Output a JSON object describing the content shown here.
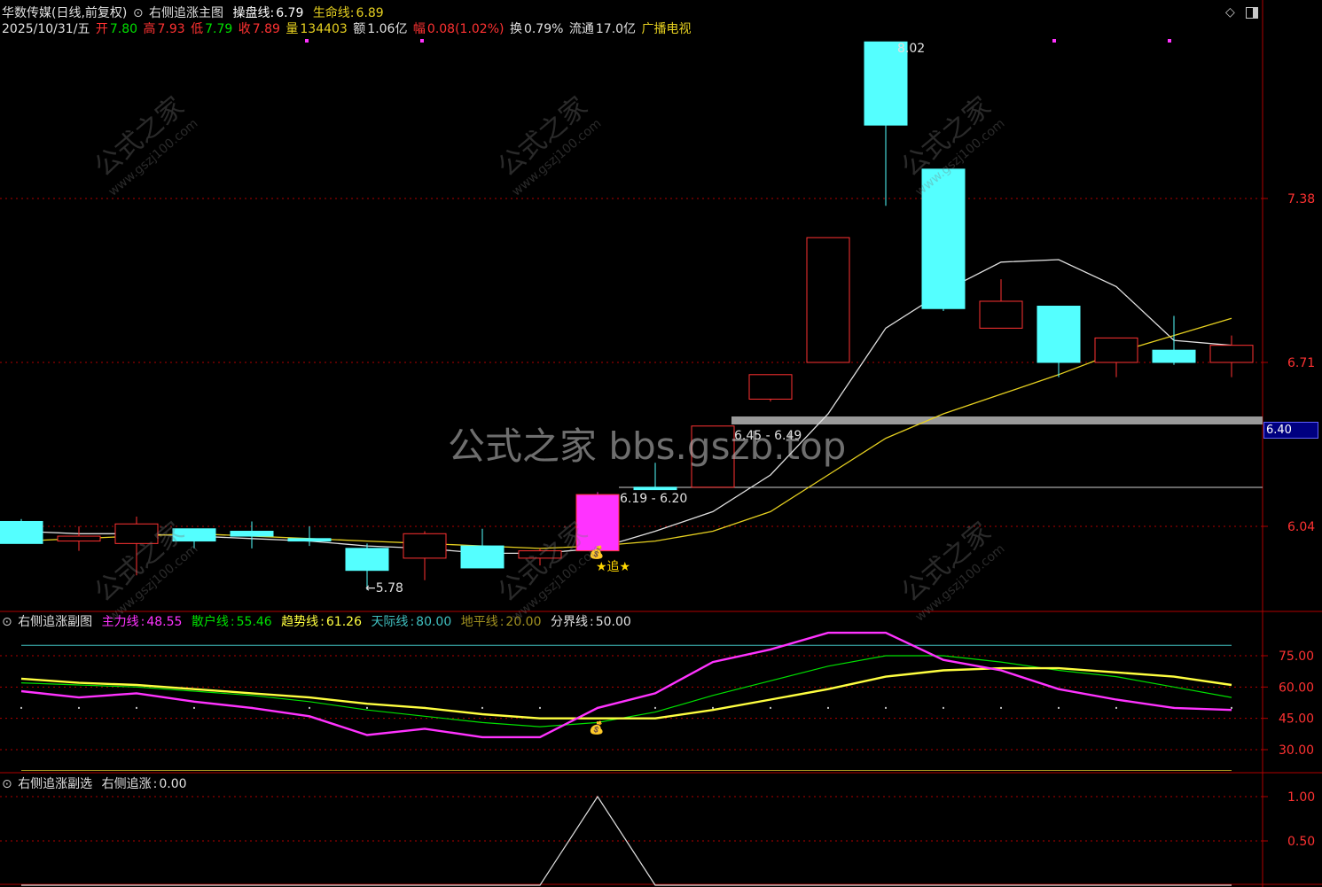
{
  "header": {
    "stock_name": "华数传媒(日线,前复权)",
    "indicator_name": "右侧追涨主图",
    "caopan_label": "操盘线:",
    "caopan_value": "6.79",
    "shengming_label": "生命线:",
    "shengming_value": "6.89",
    "date": "2025/10/31/五",
    "open_label": "开",
    "open": "7.80",
    "high_label": "高",
    "high": "7.93",
    "low_label": "低",
    "low": "7.79",
    "close_label": "收",
    "close": "7.89",
    "vol_label": "量",
    "vol": "134403",
    "amount_label": "额",
    "amount": "1.06亿",
    "change_label": "幅",
    "change": "0.08(1.02%)",
    "turnover_label": "换",
    "turnover": "0.79%",
    "float_label": "流通",
    "float": "17.0亿",
    "sector": "广播电视"
  },
  "watermark": "公式之家 bbs.gszb.top",
  "watermark_small": "公式之家",
  "watermark_url": "www.gszj100.com",
  "colors": {
    "up": "#ff3232",
    "down": "#54ffff",
    "grid": "#b00000",
    "ma_white": "#e0e0e0",
    "ma_yellow": "#e6d020",
    "magenta": "#ff33ff",
    "green": "#00e000",
    "yellow": "#ffff40",
    "cyan": "#40c0c0"
  },
  "chart_data": [
    {
      "type": "candlestick",
      "title": "右侧追涨主图",
      "y_ticks": [
        "7.38",
        "6.71",
        "6.04"
      ],
      "current_price_tag": "6.40",
      "ylim": [
        5.68,
        8.15
      ],
      "candles": [
        {
          "o": 6.06,
          "h": 6.07,
          "l": 5.97,
          "c": 5.97
        },
        {
          "o": 5.98,
          "h": 6.04,
          "l": 5.94,
          "c": 6.0
        },
        {
          "o": 5.97,
          "h": 6.08,
          "l": 5.84,
          "c": 6.05
        },
        {
          "o": 6.03,
          "h": 6.03,
          "l": 5.95,
          "c": 5.98
        },
        {
          "o": 6.02,
          "h": 6.06,
          "l": 5.95,
          "c": 6.0
        },
        {
          "o": 5.99,
          "h": 6.04,
          "l": 5.96,
          "c": 5.98
        },
        {
          "o": 5.95,
          "h": 5.97,
          "l": 5.78,
          "c": 5.86
        },
        {
          "o": 5.91,
          "h": 6.02,
          "l": 5.82,
          "c": 6.01
        },
        {
          "o": 5.96,
          "h": 6.03,
          "l": 5.88,
          "c": 5.87
        },
        {
          "o": 5.91,
          "h": 5.95,
          "l": 5.88,
          "c": 5.94
        },
        {
          "o": 5.94,
          "h": 6.18,
          "l": 5.93,
          "c": 6.17,
          "signal": true
        },
        {
          "o": 6.2,
          "h": 6.3,
          "l": 6.19,
          "c": 6.19
        },
        {
          "o": 6.2,
          "h": 6.45,
          "l": 6.2,
          "c": 6.45
        },
        {
          "o": 6.56,
          "h": 6.66,
          "l": 6.55,
          "c": 6.66
        },
        {
          "o": 6.71,
          "h": 7.22,
          "l": 6.71,
          "c": 7.22
        },
        {
          "o": 8.02,
          "h": 8.02,
          "l": 7.35,
          "c": 7.68
        },
        {
          "o": 7.5,
          "h": 7.5,
          "l": 6.92,
          "c": 6.93
        },
        {
          "o": 6.85,
          "h": 7.05,
          "l": 6.85,
          "c": 6.96
        },
        {
          "o": 6.94,
          "h": 6.94,
          "l": 6.65,
          "c": 6.71
        },
        {
          "o": 6.71,
          "h": 6.78,
          "l": 6.65,
          "c": 6.81
        },
        {
          "o": 6.76,
          "h": 6.9,
          "l": 6.7,
          "c": 6.71
        },
        {
          "o": 6.71,
          "h": 6.82,
          "l": 6.65,
          "c": 6.78
        }
      ],
      "ma_white": [
        6.02,
        6.01,
        6.01,
        6.0,
        5.99,
        5.98,
        5.96,
        5.95,
        5.93,
        5.93,
        5.95,
        6.02,
        6.1,
        6.25,
        6.5,
        6.85,
        7.0,
        7.12,
        7.13,
        7.02,
        6.8,
        6.78
      ],
      "ma_yellow": [
        5.98,
        5.99,
        6.0,
        6.01,
        6.0,
        5.99,
        5.98,
        5.97,
        5.96,
        5.95,
        5.96,
        5.98,
        6.02,
        6.1,
        6.25,
        6.4,
        6.5,
        6.58,
        6.66,
        6.75,
        6.82,
        6.89
      ],
      "annotations": {
        "low_label": "←5.78",
        "range1": "6.19 - 6.20",
        "range2": "6.45 - 6.49",
        "peak_label": "8.02",
        "signal_label": "★追★"
      }
    },
    {
      "type": "line",
      "title": "右侧追涨副图",
      "y_ticks": [
        "75.00",
        "60.00",
        "45.00",
        "30.00"
      ],
      "ylim": [
        23,
        98
      ],
      "series": [
        {
          "name": "主力线",
          "value_label": "48.55",
          "values": [
            58,
            55,
            57,
            53,
            50,
            46,
            37,
            40,
            36,
            36,
            50,
            57,
            72,
            78,
            86,
            86,
            73,
            68,
            59,
            54,
            50,
            49
          ]
        },
        {
          "name": "散户线",
          "value_label": "55.46",
          "values": [
            62,
            61,
            60,
            58,
            56,
            53,
            49,
            46,
            43,
            41,
            43,
            48,
            56,
            63,
            70,
            75,
            75,
            72,
            68,
            65,
            60,
            55
          ]
        },
        {
          "name": "趋势线",
          "value_label": "61.26",
          "values": [
            64,
            62,
            61,
            59,
            57,
            55,
            52,
            50,
            47,
            45,
            45,
            45,
            49,
            54,
            59,
            65,
            68,
            69,
            69,
            67,
            65,
            61
          ]
        },
        {
          "name": "天际线",
          "value_label": "80.00"
        },
        {
          "name": "地平线",
          "value_label": "20.00"
        },
        {
          "name": "分界线",
          "value_label": "50.00"
        }
      ]
    },
    {
      "type": "line",
      "title": "右侧追涨副选",
      "y_ticks": [
        "1.00",
        "0.50"
      ],
      "ylim": [
        0,
        1.2
      ],
      "series": [
        {
          "name": "右侧追涨",
          "value_label": "0.00",
          "values": [
            0,
            0,
            0,
            0,
            0,
            0,
            0,
            0,
            0,
            0,
            1,
            0,
            0,
            0,
            0,
            0,
            0,
            0,
            0,
            0,
            0,
            0
          ]
        }
      ]
    }
  ]
}
